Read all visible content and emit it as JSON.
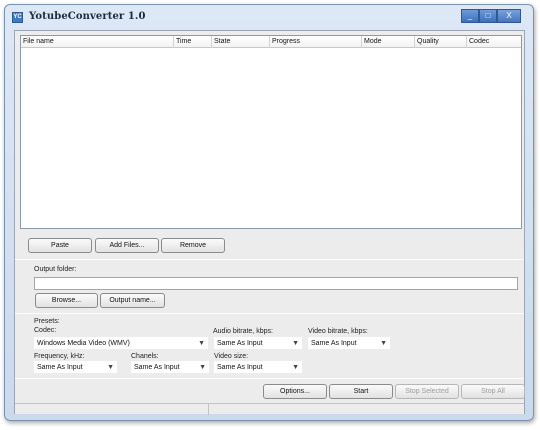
{
  "window": {
    "title": "YotubeConverter 1.0",
    "icon_label": "YC",
    "controls": {
      "minimize": "_",
      "maximize": "□",
      "close": "X"
    }
  },
  "file_list": {
    "columns": [
      "File name",
      "Time",
      "State",
      "Progress",
      "Mode",
      "Quality",
      "Codec"
    ]
  },
  "list_buttons": {
    "paste": "Paste",
    "add_files": "Add Files...",
    "remove": "Remove"
  },
  "output": {
    "label": "Output folder:",
    "value": "",
    "browse": "Browse...",
    "output_name": "Output name..."
  },
  "presets": {
    "label": "Presets:",
    "codec_label": "Codec:",
    "codec_value": "Windows Media Video (WMV)",
    "audio_bitrate_label": "Audio bitrate, kbps:",
    "audio_bitrate_value": "Same As Input",
    "video_bitrate_label": "Video bitrate, kbps:",
    "video_bitrate_value": "Same As Input",
    "frequency_label": "Frequency, kHz:",
    "frequency_value": "Same As Input",
    "chanels_label": "Chanels:",
    "chanels_value": "Same As Input",
    "video_size_label": "Video size:",
    "video_size_value": "Same As Input"
  },
  "actions": {
    "options": "Options...",
    "start": "Start",
    "stop_selected": "Stop Selected",
    "stop_all": "Stop All"
  },
  "icons": {
    "dropdown": "▼"
  }
}
